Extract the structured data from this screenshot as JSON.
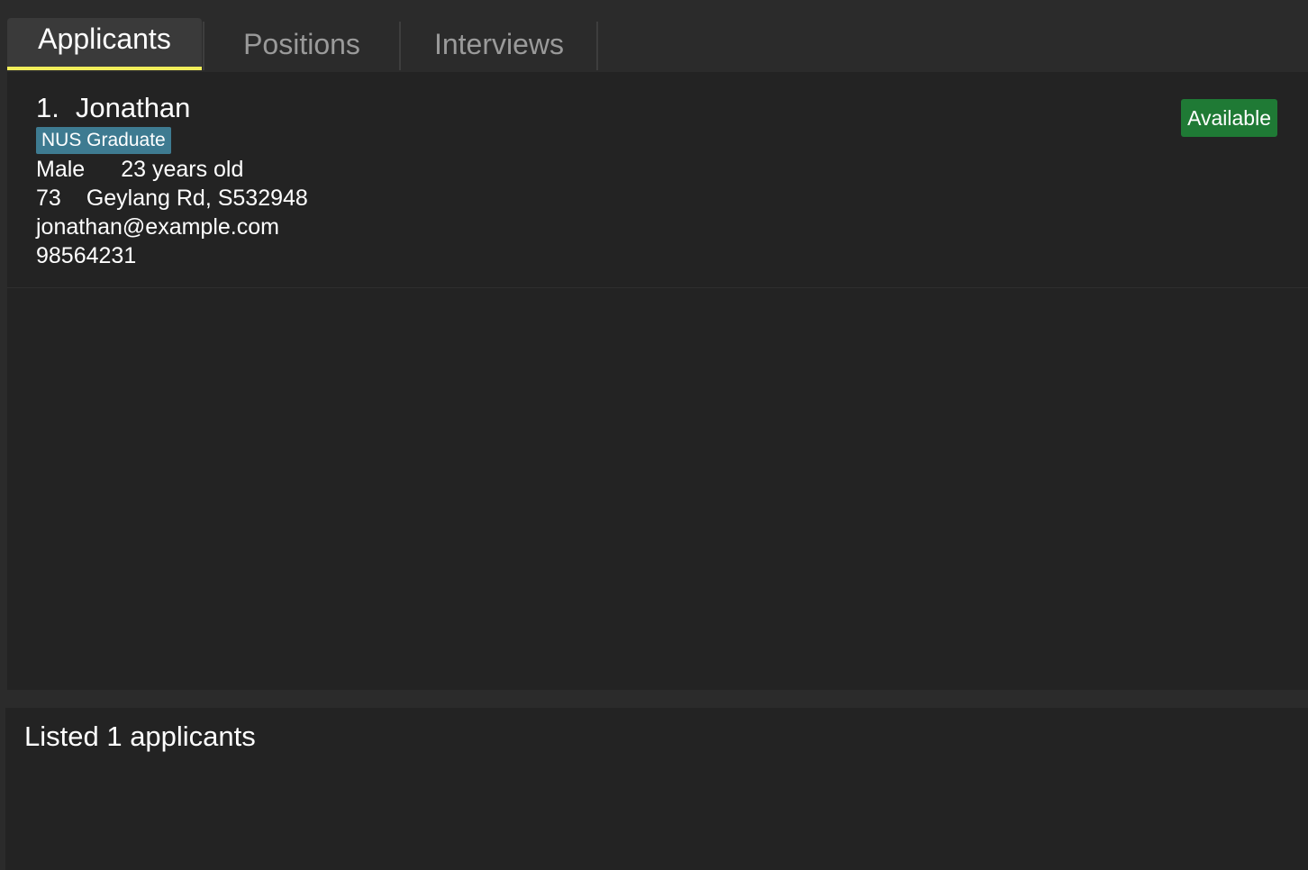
{
  "tabs": [
    {
      "label": "Applicants",
      "active": true
    },
    {
      "label": "Positions",
      "active": false
    },
    {
      "label": "Interviews",
      "active": false
    }
  ],
  "applicants": [
    {
      "index": "1.",
      "name": "Jonathan",
      "tag": "NUS Graduate",
      "gender": "Male",
      "age": "23 years old",
      "address_number": "73",
      "address_street": "Geylang Rd, S532948",
      "email": "jonathan@example.com",
      "phone": "98564231",
      "status": "Available"
    }
  ],
  "result": {
    "message": "Listed 1 applicants"
  },
  "colors": {
    "active_tab_underline": "#f2ee5a",
    "tag_background": "#3e7b91",
    "status_available": "#1f7a35",
    "panel_background": "#232323"
  }
}
